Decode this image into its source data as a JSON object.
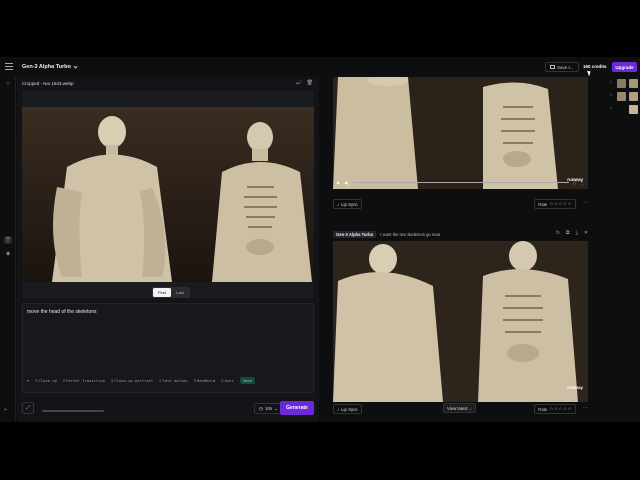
{
  "topbar": {
    "model_title": "Gen-3 Alpha Turbo",
    "save_label": "Save t...",
    "credits": "160 credits",
    "upgrade_label": "Upgrade"
  },
  "left_panel": {
    "file_name": "Cropped - two 1643.webp",
    "segment": {
      "first": "First",
      "last": "Last"
    },
    "prompt": "move the head of the skeletons",
    "presets": [
      "Close up",
      "Portal transition",
      "Close-up portrait",
      "Fast motion",
      "Handheld",
      "Over"
    ],
    "save_preset": "Save",
    "duration": "10s",
    "generate_label": "Generate"
  },
  "feed": {
    "lip_sync_label": "Lip Sync",
    "rate_label": "Rate",
    "stars": "☆☆☆☆☆",
    "watermark": "runway",
    "gen_model": "Gen-3 Alpha Turbo",
    "gen_prompt": "I want the two skeletons go near",
    "view_latest": "View latest",
    "thumb_numbers": [
      "1",
      "2",
      "3"
    ]
  },
  "icons": [
    "menu-icon",
    "chevron-down-icon",
    "folder-icon",
    "cursor-icon",
    "rotate-icon",
    "trash-icon",
    "text-tool-icon",
    "layers-icon",
    "expand-icon",
    "clock-icon",
    "play-icon",
    "volume-icon",
    "fullscreen-icon",
    "more-icon",
    "retry-icon",
    "copy-icon",
    "download-icon",
    "close-icon"
  ],
  "colors": {
    "accent": "#6d28d9",
    "background": "#0d0e10",
    "panel": "#131417"
  }
}
